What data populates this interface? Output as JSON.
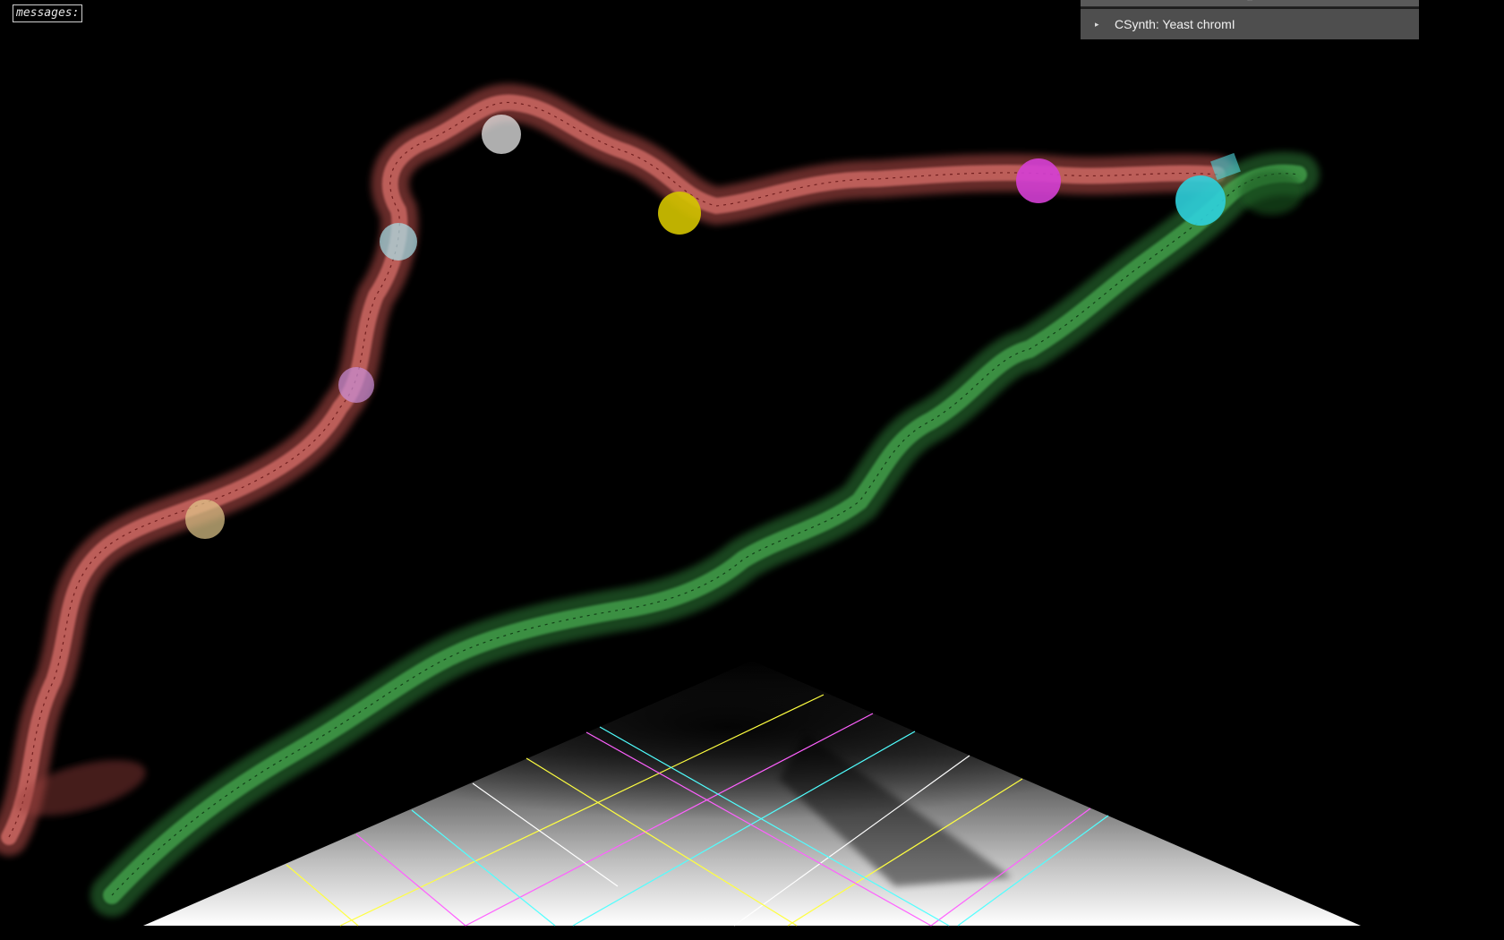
{
  "messages_label": "messages:",
  "gui": {
    "close_label": "...",
    "folder_label": "CSynth: Yeast chromI",
    "folder_arrow": "▸"
  },
  "colors": {
    "chain_red": "#c9605d",
    "chain_green": "#3f9a48",
    "marker_yellow": "#e0d000",
    "marker_magenta": "#e040e0",
    "marker_cyan": "#30d0e0",
    "marker_white": "#ffffff"
  }
}
